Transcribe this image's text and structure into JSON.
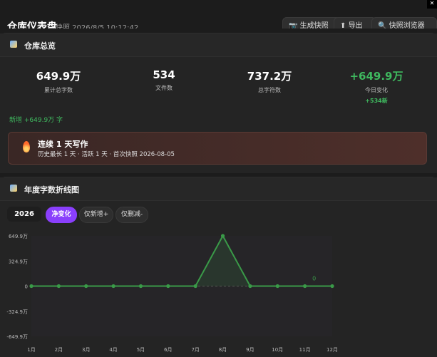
{
  "header": {
    "title": "仓库仪表盘",
    "snapshot": "快照 2026/8/5 10:12:42",
    "buttons": [
      "生成快照",
      "导出",
      "快照浏览器"
    ]
  },
  "overview": {
    "title": "仓库总览",
    "stats": [
      {
        "value": "649.9万",
        "label": "累计总字数"
      },
      {
        "value": "534",
        "label": "文件数"
      },
      {
        "value": "737.2万",
        "label": "总字符数"
      },
      {
        "value": "+649.9万",
        "label": "今日变化",
        "sub": "+534新"
      }
    ],
    "new_line": "新增 +649.9万 字",
    "streak_title": "连续 1 天写作",
    "streak_detail": "历史最长 1 天 · 活跃 1 天 · 首次快照 2026-08-05"
  },
  "chart_section": {
    "title": "年度字数折线图",
    "year": "2026",
    "tabs": [
      "净变化",
      "仅新增+",
      "仅删减-"
    ],
    "active_tab": 0
  },
  "chart_data": {
    "type": "line",
    "categories": [
      "1月",
      "2月",
      "3月",
      "4月",
      "5月",
      "6月",
      "7月",
      "8月",
      "9月",
      "10月",
      "11月",
      "12月"
    ],
    "series": [
      {
        "values": [
          0,
          0,
          0,
          0,
          0,
          0,
          0,
          649.9,
          0,
          0,
          0,
          0
        ]
      }
    ],
    "y_ticks": [
      "649.9万",
      "324.9万",
      "0",
      "-324.9万",
      "-649.9万"
    ],
    "ylim": [
      -649.9,
      649.9
    ],
    "point_label": {
      "index": 10,
      "text": "0"
    },
    "color": "#3a9a48"
  }
}
